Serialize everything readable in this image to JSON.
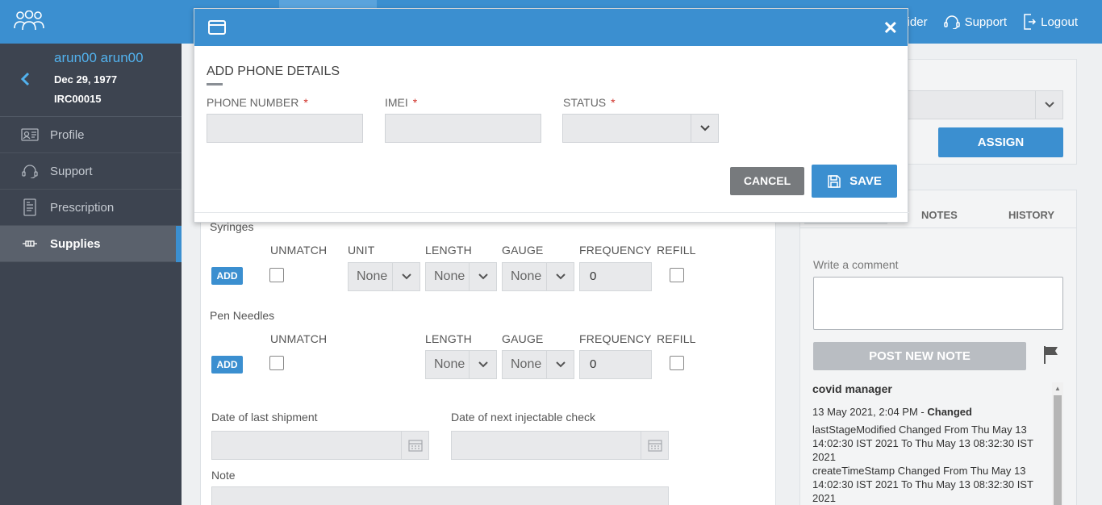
{
  "topbar": {
    "logo_icon": "group-users-icon",
    "right_items": [
      {
        "label": "ider",
        "icon": "provider-icon"
      },
      {
        "label": "Support",
        "icon": "headset-icon"
      },
      {
        "label": "Logout",
        "icon": "logout-icon"
      }
    ]
  },
  "sidebar": {
    "patient": {
      "name": "arun00 arun00",
      "dob": "Dec 29, 1977",
      "id": "IRC00015"
    },
    "items": [
      {
        "label": "Profile",
        "icon": "id-card-icon"
      },
      {
        "label": "Support",
        "icon": "headset-icon"
      },
      {
        "label": "Prescription",
        "icon": "prescription-icon"
      },
      {
        "label": "Supplies",
        "icon": "supplies-icon",
        "active": true
      }
    ]
  },
  "supplies": {
    "syringes": {
      "title": "Syringes",
      "add_label": "ADD",
      "columns": [
        "UNMATCH",
        "UNIT",
        "LENGTH",
        "GAUGE",
        "FREQUENCY",
        "REFILL"
      ],
      "unit": "None",
      "length": "None",
      "gauge": "None",
      "frequency": "0"
    },
    "pen_needles": {
      "title": "Pen Needles",
      "add_label": "ADD",
      "columns": [
        "UNMATCH",
        "LENGTH",
        "GAUGE",
        "FREQUENCY",
        "REFILL"
      ],
      "length": "None",
      "gauge": "None",
      "frequency": "0"
    },
    "date_last_shipment_label": "Date of last shipment",
    "date_next_check_label": "Date of next injectable check",
    "note_label": "Note"
  },
  "right": {
    "assign_label": "ASSIGN",
    "tabs": [
      "NOTES",
      "HISTORY"
    ],
    "comment_label": "Write a comment",
    "post_label": "POST NEW NOTE",
    "history": {
      "author": "covid manager",
      "date": "13 May 2021, 2:04 PM - ",
      "action": "Changed",
      "entries": [
        "lastStageModified Changed From Thu May 13 14:02:30 IST 2021 To Thu May 13 08:32:30 IST 2021",
        "createTimeStamp Changed From Thu May 13 14:02:30 IST 2021 To Thu May 13 08:32:30 IST 2021"
      ]
    }
  },
  "modal": {
    "title": "ADD PHONE DETAILS",
    "fields": {
      "phone_label": "PHONE NUMBER",
      "imei_label": "IMEI",
      "status_label": "STATUS",
      "required_mark": "*"
    },
    "cancel_label": "CANCEL",
    "save_label": "SAVE"
  },
  "colors": {
    "primary": "#3b8fd0",
    "sidebar": "#3d4450",
    "required": "#d0342c"
  }
}
